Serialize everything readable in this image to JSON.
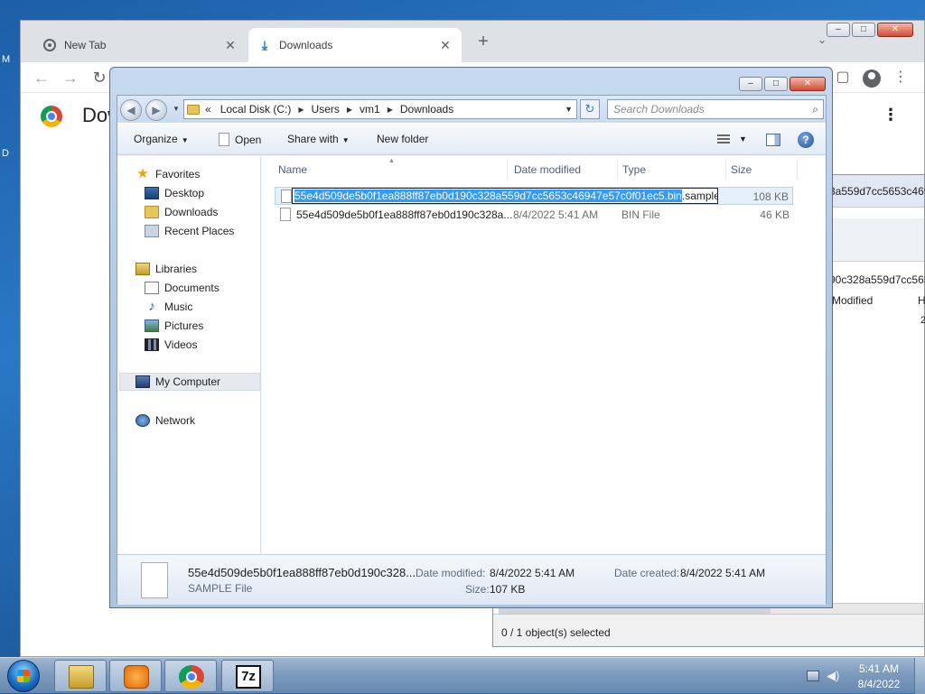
{
  "desktop": {
    "edge_letters": [
      "M",
      "D"
    ]
  },
  "chrome": {
    "tabs": [
      {
        "label": "New Tab",
        "active": false
      },
      {
        "label": "Downloads",
        "active": true
      }
    ],
    "page_title": "Dow"
  },
  "seven_zip": {
    "path_fragment": "3a559d7cc5653c4694",
    "path_fragment2": "90c328a559d7cc565",
    "col_modified": "Modified",
    "col_edge": "H",
    "col_edge_value": "2",
    "status": "0 / 1 object(s) selected"
  },
  "dialog": {
    "address": {
      "prefix": "«",
      "segments": [
        "Local Disk (C:)",
        "Users",
        "vm1",
        "Downloads"
      ]
    },
    "search_placeholder": "Search Downloads",
    "toolbar": {
      "organize": "Organize",
      "open": "Open",
      "share_with": "Share with",
      "new_folder": "New folder"
    },
    "nav": {
      "favorites": "Favorites",
      "desktop": "Desktop",
      "downloads": "Downloads",
      "recent_places": "Recent Places",
      "libraries": "Libraries",
      "documents": "Documents",
      "music": "Music",
      "pictures": "Pictures",
      "videos": "Videos",
      "my_computer": "My Computer",
      "network": "Network"
    },
    "columns": {
      "name": "Name",
      "date_modified": "Date modified",
      "type": "Type",
      "size": "Size"
    },
    "files": [
      {
        "rename_selected": "55e4d509de5b0f1ea888ff87eb0d190c328a559d7cc5653c46947e57c0f01ec5.bin",
        "rename_rest": ".sample",
        "size": "108 KB"
      },
      {
        "name": "55e4d509de5b0f1ea888ff87eb0d190c328a...",
        "date": "8/4/2022 5:41 AM",
        "type": "BIN File",
        "size": "46 KB"
      }
    ],
    "details": {
      "name": "55e4d509de5b0f1ea888ff87eb0d190c328...",
      "type": "SAMPLE File",
      "date_modified_label": "Date modified:",
      "date_modified": "8/4/2022 5:41 AM",
      "date_created_label": "Date created:",
      "date_created": "8/4/2022 5:41 AM",
      "size_label": "Size:",
      "size": "107 KB"
    }
  },
  "taskbar": {
    "clock_time": "5:41 AM",
    "clock_date": "8/4/2022",
    "pinned": [
      "explorer",
      "media-player",
      "chrome",
      "7zip"
    ]
  }
}
